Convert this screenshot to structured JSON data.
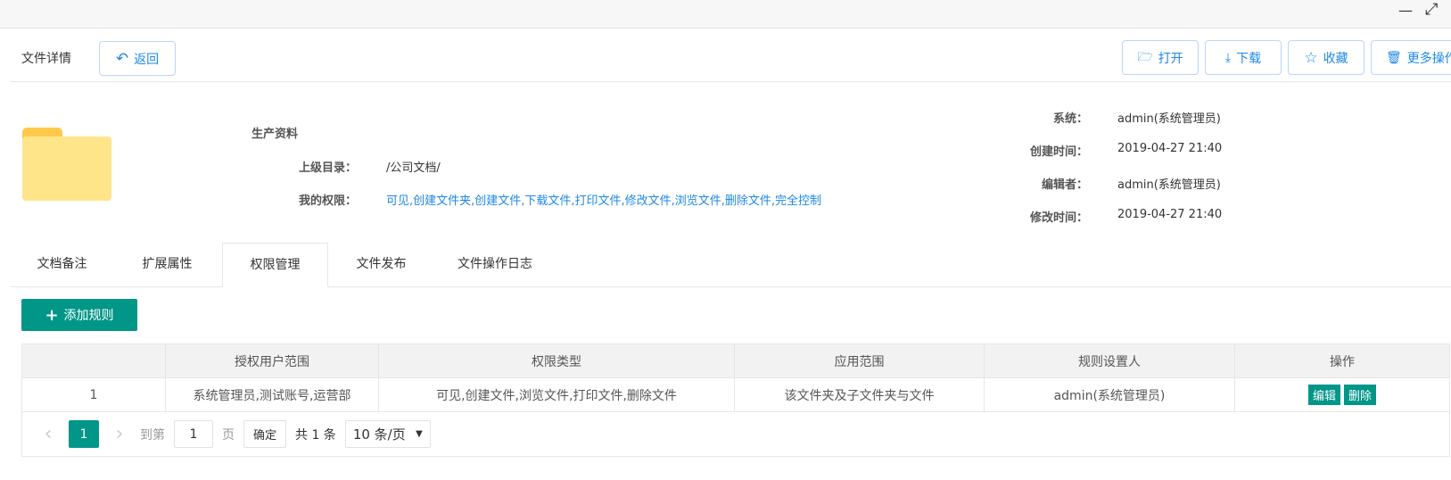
{
  "window": {
    "minimize": "—",
    "maximize": "⤢"
  },
  "header": {
    "title": "文件详情",
    "back": "返回",
    "open": "打开",
    "download": "下载",
    "favorite": "收藏",
    "more": "更多操作"
  },
  "file": {
    "name": "生产资料",
    "parent_label": "上级目录：",
    "parent": "/公司文档/",
    "perm_label": "我的权限：",
    "perms": "可见,创建文件夹,创建文件,下载文件,打印文件,修改文件,浏览文件,删除文件,完全控制",
    "system_label": "系统：",
    "system": "admin(系统管理员)",
    "created_label": "创建时间：",
    "created": "2019-04-27 21:40",
    "editor_label": "编辑者：",
    "editor": "admin(系统管理员)",
    "modified_label": "修改时间：",
    "modified": "2019-04-27 21:40"
  },
  "tabs": [
    "文档备注",
    "扩展属性",
    "权限管理",
    "文件发布",
    "文件操作日志"
  ],
  "add_rule": "添加规则",
  "table": {
    "headers": [
      "",
      "授权用户范围",
      "权限类型",
      "应用范围",
      "规则设置人",
      "操作"
    ],
    "rows": [
      {
        "index": "1",
        "users": "系统管理员,测试账号,运营部",
        "type": "可见,创建文件,浏览文件,打印文件,删除文件",
        "scope": "该文件夹及子文件夹与文件",
        "setter": "admin(系统管理员)",
        "edit": "编辑",
        "delete": "删除"
      }
    ]
  },
  "pager": {
    "prev": "‹",
    "current": "1",
    "next": "›",
    "goto": "到第",
    "page_input": "1",
    "page_unit": "页",
    "confirm": "确定",
    "total": "共 1 条",
    "page_size": "10 条/页"
  },
  "colors": {
    "accent": "#009688",
    "link": "#1e88e5"
  }
}
